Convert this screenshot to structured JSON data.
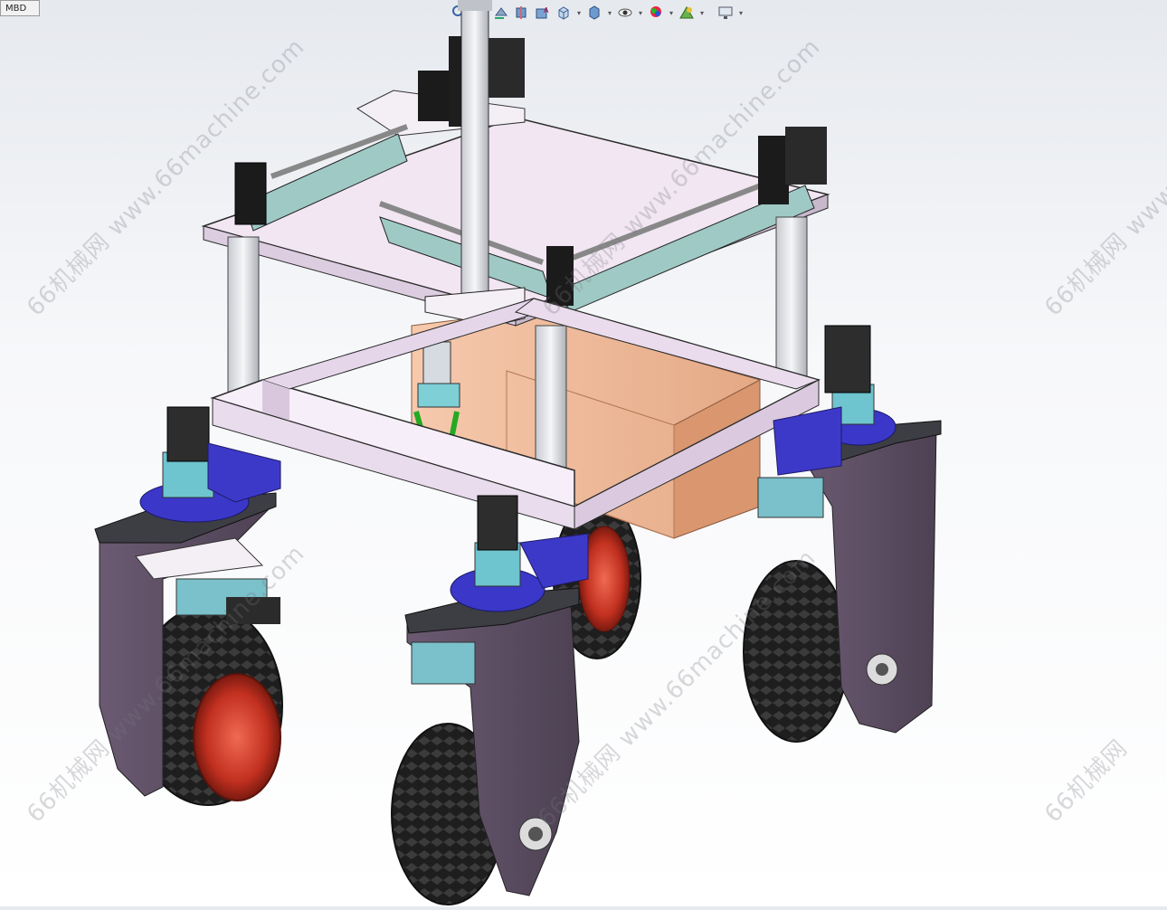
{
  "tab": {
    "label": "MBD"
  },
  "toolbar": {
    "icons": [
      "zoom-fit-icon",
      "zoom-area-icon",
      "previous-view-icon",
      "section-view-icon",
      "dynamic-annotation-icon",
      "view-orientation-icon",
      "display-style-icon",
      "hide-show-icon",
      "edit-appearance-icon",
      "apply-scene-icon",
      "view-settings-icon"
    ],
    "caret": "▾"
  },
  "watermarks": [
    "66机械网 www.66machine.com",
    "66机械网 www.66machine.com",
    "66机械网 www.66machine.com",
    "66机械网 www.66machine.com",
    "66机械网 www.66machine.com",
    "66机械网"
  ],
  "colors": {
    "frame": "#eee2f0",
    "frame_edge": "#2c2c2c",
    "tire": "#1c1c1c",
    "rim": "#cc3b2b",
    "arm": "#5c4e62",
    "motor_mount": "#3d39c8",
    "box": "#f1c0a2",
    "rail": "#a9d1cc"
  }
}
